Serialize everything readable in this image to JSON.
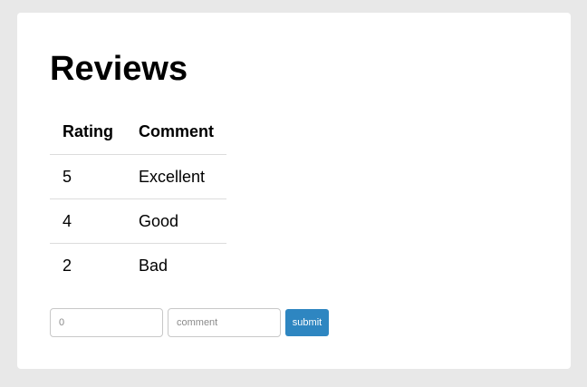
{
  "page": {
    "title": "Reviews"
  },
  "table": {
    "headers": [
      "Rating",
      "Comment"
    ],
    "rows": [
      {
        "rating": "5",
        "comment": "Excellent"
      },
      {
        "rating": "4",
        "comment": "Good"
      },
      {
        "rating": "2",
        "comment": "Bad"
      }
    ]
  },
  "form": {
    "rating_value": "0",
    "rating_placeholder": "0",
    "comment_value": "",
    "comment_placeholder": "comment",
    "submit_label": "submit"
  },
  "colors": {
    "page_background": "#e8e8e8",
    "card_background": "#ffffff",
    "submit_button": "#2e86c1"
  }
}
